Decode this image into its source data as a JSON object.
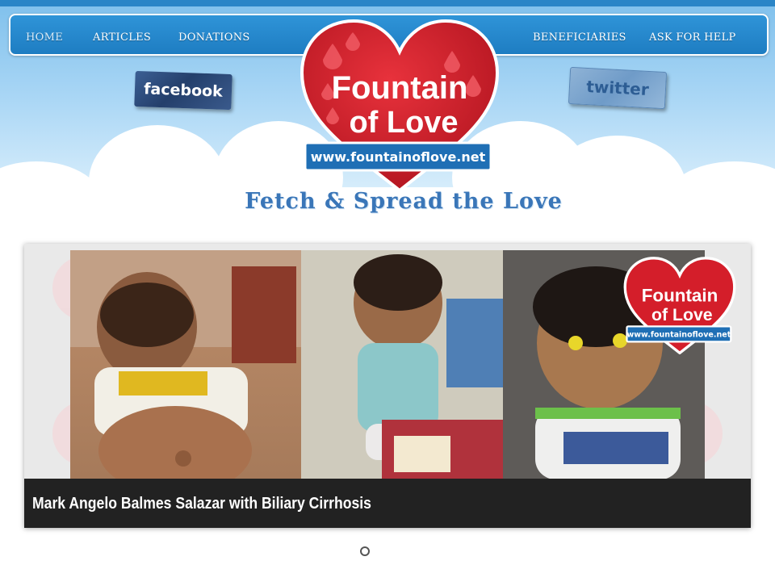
{
  "nav": {
    "left": [
      {
        "label": "HOME"
      },
      {
        "label": "ARTICLES"
      },
      {
        "label": "DONATIONS"
      }
    ],
    "right": [
      {
        "label": "BENEFICIARIES"
      },
      {
        "label": "ASK FOR HELP"
      }
    ]
  },
  "social": {
    "facebook_label": "facebook",
    "twitter_label": "twitter"
  },
  "logo": {
    "line1": "Fountain",
    "line2": "of Love",
    "url": "www.fountainoflove.net"
  },
  "tagline": "Fetch & Spread the Love",
  "slider": {
    "caption": "Mark Angelo Balmes Salazar with Biliary Cirrhosis",
    "watermark": {
      "line1": "Fountain",
      "line2": "of Love",
      "url": "www.fountainoflove.net"
    },
    "active_slide": 1,
    "slide_count": 1
  },
  "colors": {
    "nav_blue": "#2f94d8",
    "heart_red": "#d41e2a",
    "caption_bg": "#222222",
    "tagline_blue": "#3a76b8"
  }
}
